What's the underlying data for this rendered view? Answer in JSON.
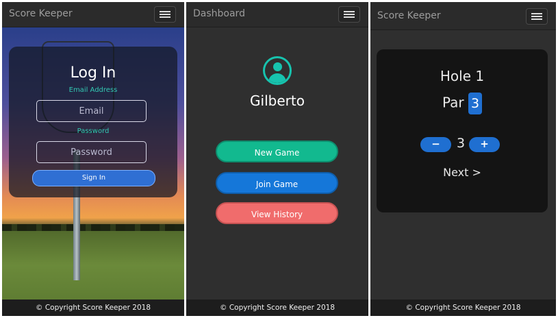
{
  "screens": [
    {
      "brand": "Score Keeper",
      "login": {
        "title": "Log In",
        "email_label": "Email Address",
        "email_placeholder": "Email",
        "password_label": "Password",
        "password_placeholder": "Password",
        "signin_label": "Sign In"
      },
      "footer": "© Copyright Score Keeper 2018"
    },
    {
      "brand": "Dashboard",
      "username": "Gilberto",
      "buttons": {
        "new_game": "New Game",
        "join_game": "Join Game",
        "view_history": "View History"
      },
      "footer": "© Copyright Score Keeper 2018"
    },
    {
      "brand": "Score Keeper",
      "hole_label": "Hole 1",
      "par_label": "Par",
      "par_value": "3",
      "minus_label": "−",
      "plus_label": "+",
      "score_value": "3",
      "next_label": "Next >",
      "footer": "© Copyright Score Keeper 2018"
    }
  ],
  "colors": {
    "accent_teal": "#17c3ae",
    "new_game": "#12b98f",
    "join_game": "#1577d9",
    "view_history": "#f06c6c",
    "par_badge": "#1f6fd1"
  },
  "icons": [
    "hamburger-menu-icon",
    "user-avatar-icon"
  ]
}
